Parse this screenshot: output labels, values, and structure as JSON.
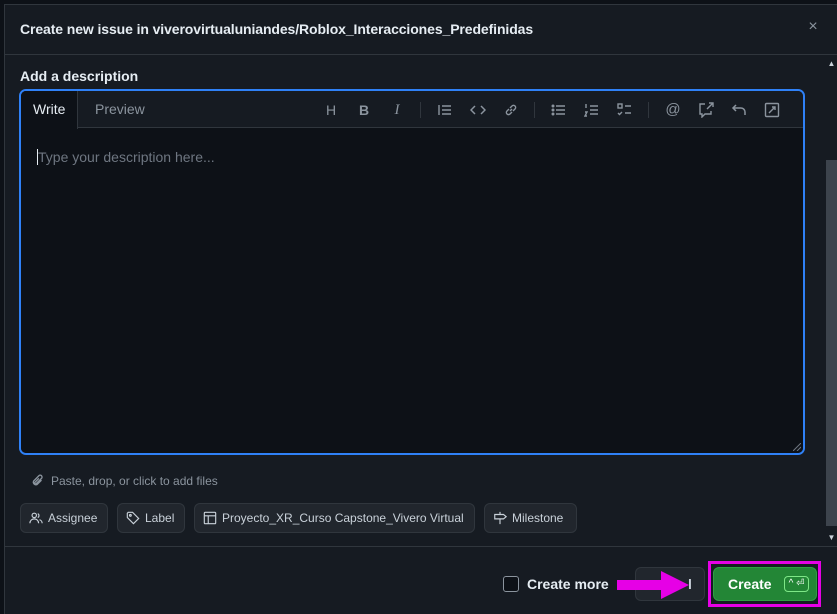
{
  "dialog": {
    "title": "Create new issue in viverovirtualuniandes/Roblox_Interacciones_Predefinidas",
    "close_icon": "×"
  },
  "description": {
    "label": "Add a description",
    "tabs": [
      "Write",
      "Preview"
    ],
    "toolbar": [
      "heading-icon",
      "bold-icon",
      "italic-icon",
      "quote-icon",
      "code-icon",
      "link-icon",
      "unordered-list-icon",
      "ordered-list-icon",
      "task-list-icon",
      "mention-icon",
      "reference-icon",
      "undo-icon",
      "fullscreen-icon"
    ],
    "placeholder": "Type your description here...",
    "attach_hint": "Paste, drop, or click to add files"
  },
  "metadata": {
    "assignee": "Assignee",
    "label": "Label",
    "project": "Proyecto_XR_Curso Capstone_Vivero Virtual",
    "milestone": "Milestone"
  },
  "footer": {
    "create_more": "Create more",
    "cancel_visible": "l",
    "create": "Create",
    "shortcut": "^ ⏎"
  },
  "colors": {
    "background": "#161b22",
    "editor_border": "#2f81f7",
    "create_button": "#238636",
    "highlight": "#e600e6"
  }
}
